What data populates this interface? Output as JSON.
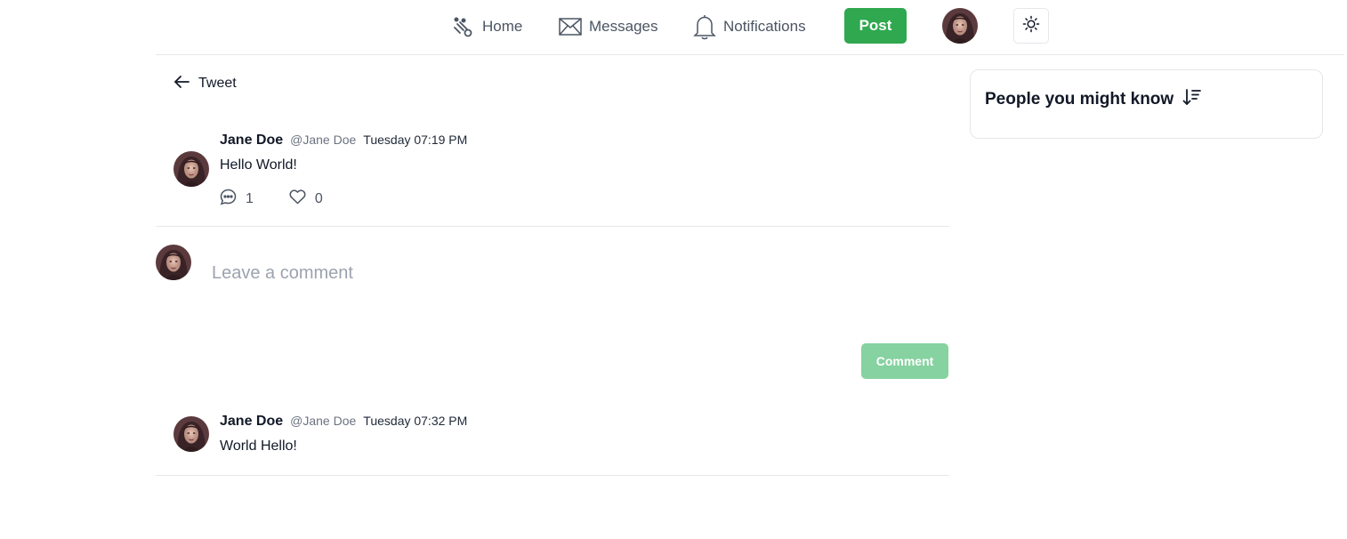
{
  "nav": {
    "home_label": "Home",
    "messages_label": "Messages",
    "notifications_label": "Notifications",
    "post_label": "Post",
    "icons": {
      "home": "home-icon",
      "messages": "envelope-icon",
      "notifications": "bell-icon",
      "theme": "sun-icon"
    }
  },
  "page": {
    "back_label": "Tweet"
  },
  "tweet": {
    "author_name": "Jane Doe",
    "author_handle": "@Jane Doe",
    "time": "Tuesday 07:19 PM",
    "text": "Hello World!",
    "comment_count": "1",
    "like_count": "0"
  },
  "composer": {
    "placeholder": "Leave a comment",
    "button_label": "Comment"
  },
  "replies": [
    {
      "author_name": "Jane Doe",
      "author_handle": "@Jane Doe",
      "time": "Tuesday 07:32 PM",
      "text": "World Hello!"
    }
  ],
  "sidebar": {
    "people_title": "People you might know"
  },
  "colors": {
    "accent": "#2fa84f",
    "accent_disabled": "#86d2a0",
    "border": "#e5e7eb"
  }
}
